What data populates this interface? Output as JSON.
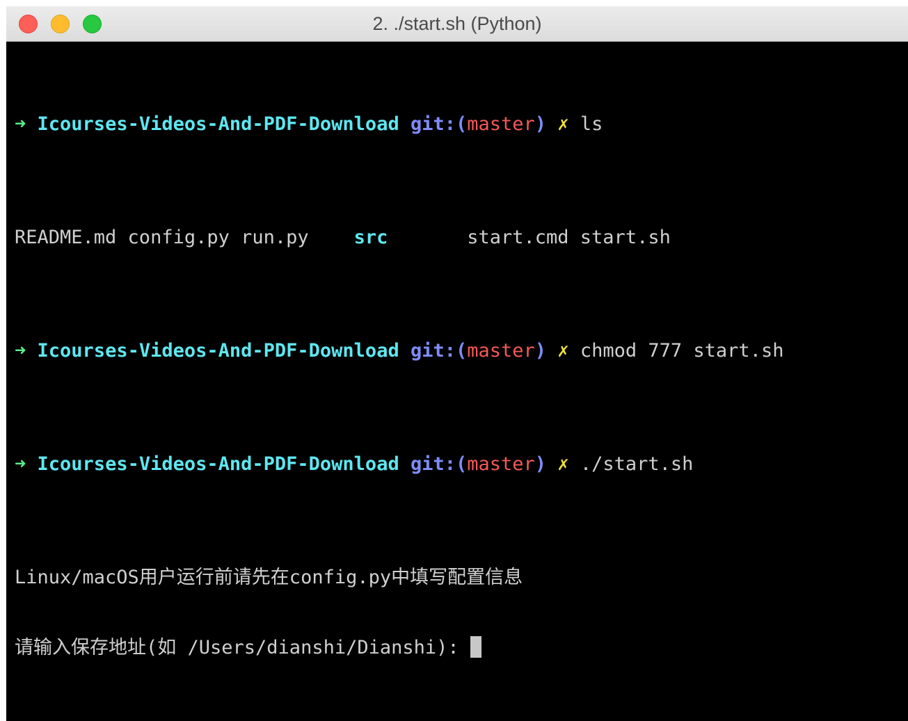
{
  "window": {
    "title": "2. ./start.sh (Python)"
  },
  "colors": {
    "background": "#000000",
    "text": "#d0d0d0",
    "prompt_arrow": "#5af08a",
    "directory": "#5ee7f0",
    "git_label": "#7f8cf8",
    "branch": "#f55858",
    "dirty_mark": "#f0e23c"
  },
  "prompt": {
    "arrow": "➜",
    "directory": "Icourses-Videos-And-PDF-Download",
    "git_open": "git:(",
    "branch": "master",
    "git_close": ")",
    "dirty": "✗"
  },
  "commands": [
    "ls",
    "chmod 777 start.sh",
    "./start.sh"
  ],
  "ls_output": {
    "files_before": "README.md config.py run.py    ",
    "dir": "src",
    "files_after": "       start.cmd start.sh"
  },
  "output_lines": [
    "Linux/macOS用户运行前请先在config.py中填写配置信息",
    "请输入保存地址(如 /Users/dianshi/Dianshi): "
  ]
}
